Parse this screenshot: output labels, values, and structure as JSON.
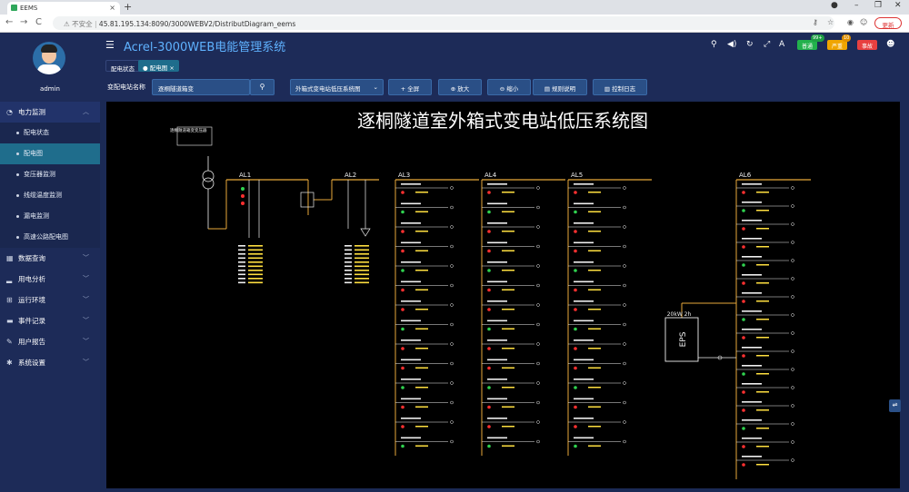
{
  "browser": {
    "tab_title": "EEMS",
    "new_tab": "+",
    "security_label": "不安全",
    "url": "45.81.195.134:8090/3000WEBV2/DistributDiagram_eems",
    "update_button": "更新",
    "nav_back": "←",
    "nav_forward": "→",
    "nav_reload": "C"
  },
  "app": {
    "title": "Acrel-3000WEB电能管理系统",
    "username": "admin",
    "badges": [
      {
        "label": "普通",
        "count": "99+",
        "color": "#22b14c",
        "count_color": "#1e9e44"
      },
      {
        "label": "严重",
        "count": "10",
        "color": "#f0a500",
        "count_color": "#e09000"
      },
      {
        "label": "事故",
        "count": "",
        "color": "#e84040",
        "count_color": "#d03030"
      }
    ]
  },
  "sidebar": {
    "items": [
      {
        "label": "电力监测",
        "icon": "gauge-icon",
        "expanded": true,
        "children": [
          "配电状态",
          "配电图",
          "变压器监测",
          "线缆温度监测",
          "漏电监测",
          "高速公路配电图"
        ]
      },
      {
        "label": "数据查询",
        "icon": "bar-chart-icon"
      },
      {
        "label": "用电分析",
        "icon": "signal-icon"
      },
      {
        "label": "运行环境",
        "icon": "sitemap-icon"
      },
      {
        "label": "事件记录",
        "icon": "folder-icon"
      },
      {
        "label": "用户报告",
        "icon": "edit-icon"
      },
      {
        "label": "系统设置",
        "icon": "wrench-icon"
      }
    ],
    "active_child": "配电图"
  },
  "breadcrumbs": [
    {
      "label": "配电状态",
      "active": false
    },
    {
      "label": "配电图",
      "active": true
    }
  ],
  "toolbar": {
    "station_label": "变配电站名称",
    "station_value": "逐桐隧道箱变",
    "diagram_select": "外箱式变电站低压系统图",
    "buttons": [
      "全屏",
      "放大",
      "缩小",
      "规则说明",
      "控制日志"
    ]
  },
  "diagram": {
    "title": "逐桐隧道室外箱式变电站低压系统图",
    "transformer_label": "逐桐隧道箱变变压器",
    "bus_labels": [
      "AL1",
      "AL2",
      "AL3",
      "AL4",
      "AL5",
      "AL6"
    ],
    "eps_label": "EPS",
    "eps_rating": "20kW 2h",
    "colors": {
      "bus": "#e8a93a",
      "wire": "#f0f0f0",
      "breaker_on": "#ff3030",
      "breaker_off": "#2fd24f",
      "value_text": "#ffe040",
      "label_text": "#f0f0f0"
    }
  }
}
